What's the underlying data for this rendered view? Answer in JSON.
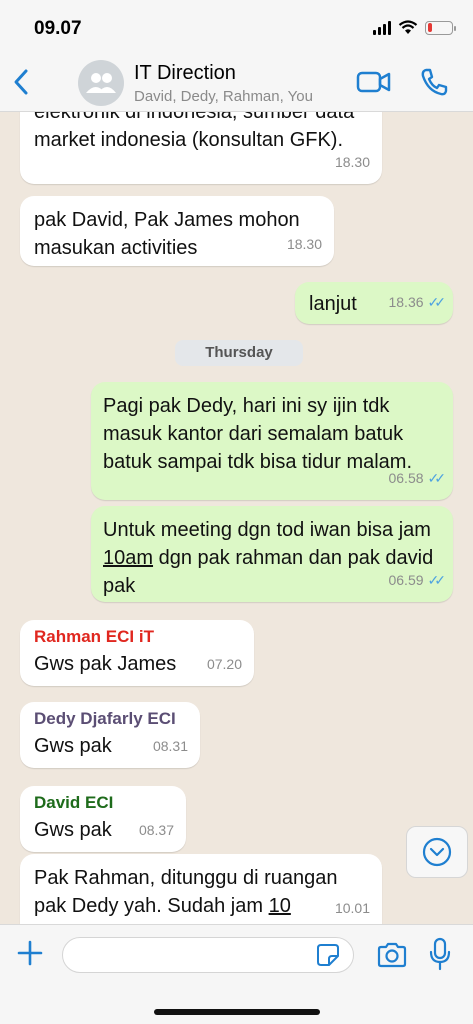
{
  "status_bar": {
    "time": "09.07"
  },
  "header": {
    "title": "IT Direction",
    "subtitle": "David, Dedy, Rahman, You"
  },
  "colors": {
    "accent": "#1f7fd0",
    "outgoing_bubble": "#dcf8c6",
    "incoming_bubble": "#ffffff",
    "read_ticks": "#4fa3e0",
    "sender_rahman": "#e0271f",
    "sender_dedy": "#5b4e74",
    "sender_david": "#1e6b1b"
  },
  "messages": [
    {
      "text": "elektronik di indonesia, sumber data market indonesia (konsultan GFK).",
      "time": "18.30"
    },
    {
      "text": "pak David, Pak James mohon masukan activities",
      "time": "18.30"
    },
    {
      "text": "lanjut",
      "time": "18.36"
    },
    {
      "text": "Pagi pak Dedy, hari ini sy ijin tdk masuk kantor dari semalam batuk batuk sampai tdk bisa tidur malam.",
      "time": "06.58"
    },
    {
      "text_before": "Untuk meeting dgn tod iwan bisa jam ",
      "text_link": "10am",
      "text_after": " dgn pak rahman dan pak david pak",
      "time": "06.59"
    },
    {
      "sender": "Rahman ECI iT",
      "text": "Gws pak James",
      "time": "07.20"
    },
    {
      "sender": "Dedy Djafarly ECI",
      "text": "Gws pak",
      "time": "08.31"
    },
    {
      "sender": "David ECI",
      "text": "Gws pak",
      "time": "08.37"
    },
    {
      "text_before": "Pak Rahman, ditunggu di ruangan pak Dedy yah. Sudah jam ",
      "text_link": "10",
      "time": "10.01"
    }
  ],
  "day_separator": "Thursday",
  "composer": {
    "placeholder": ""
  },
  "icons": [
    "back-chevron-icon",
    "group-avatar-icon",
    "video-call-icon",
    "phone-icon",
    "plus-icon",
    "sticker-icon",
    "camera-icon",
    "microphone-icon",
    "chevron-down-icon"
  ]
}
